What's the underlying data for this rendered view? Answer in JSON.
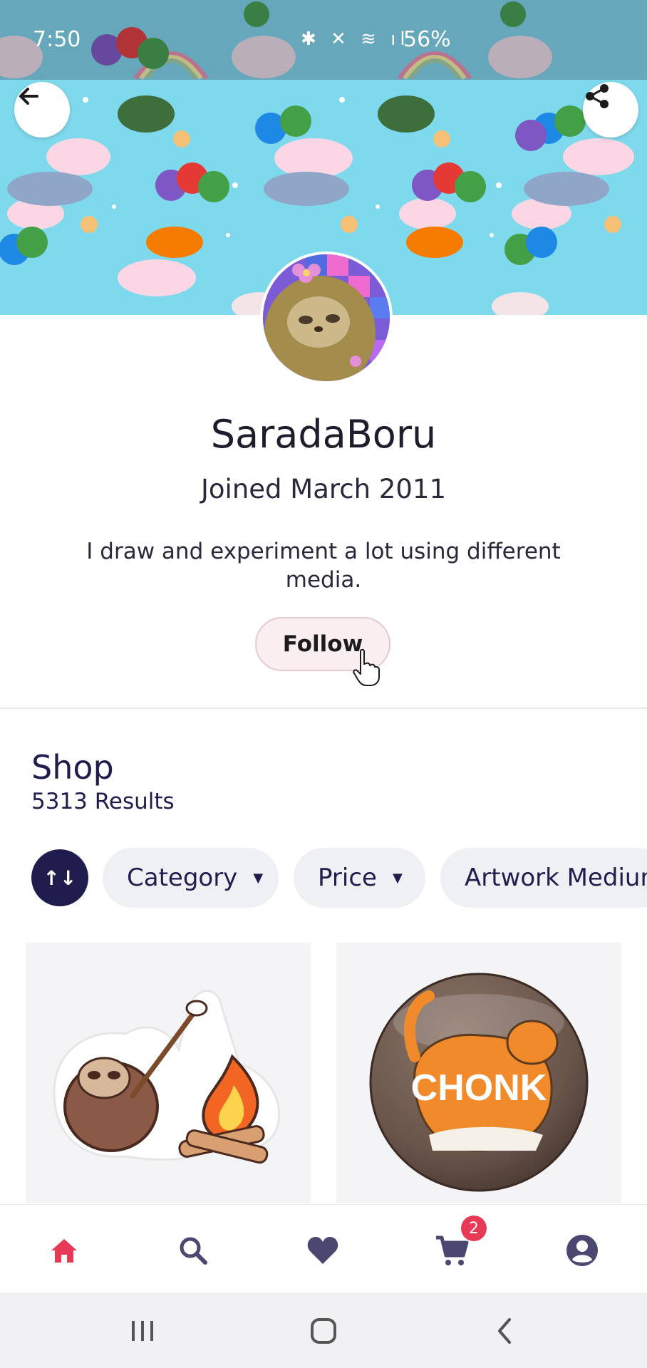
{
  "status_bar": {
    "time": "7:50",
    "battery": "56%"
  },
  "profile": {
    "username": "SaradaBoru",
    "joined": "Joined March 2011",
    "bio": "I draw and experiment a lot using different media.",
    "follow_label": "Follow"
  },
  "shop": {
    "title": "Shop",
    "results": "5313 Results",
    "filters": [
      {
        "label": "Category"
      },
      {
        "label": "Price"
      },
      {
        "label": "Artwork Medium"
      }
    ],
    "sort_label": "↑↓"
  },
  "products": [
    {
      "icon": "sloth-campfire-sticker"
    },
    {
      "icon": "chonk-cat-button",
      "text": "CHONK"
    }
  ],
  "bottom_nav": {
    "items": [
      "home-icon",
      "search-icon",
      "heart-icon",
      "cart-icon",
      "account-icon"
    ],
    "cart_count": "2",
    "active": "home"
  },
  "colors": {
    "accent": "#e63a57",
    "navy": "#1f1d4d",
    "banner_bg": "#7fd9ec"
  }
}
